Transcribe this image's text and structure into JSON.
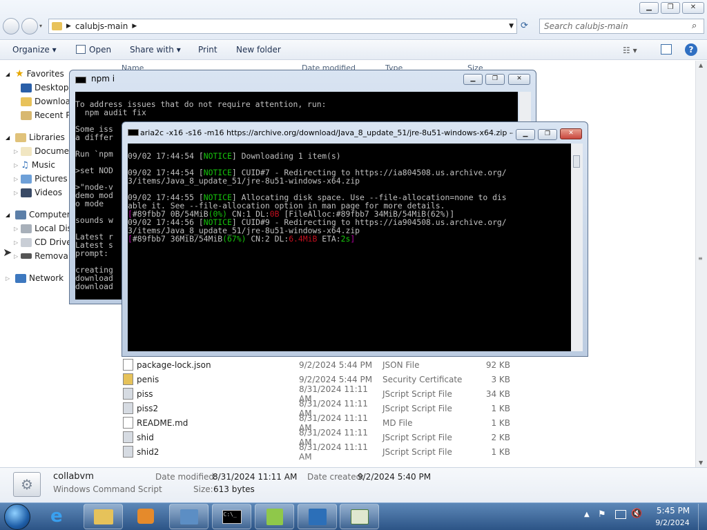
{
  "explorer": {
    "breadcrumb": "calubjs-main",
    "search_placeholder": "Search calubjs-main",
    "toolbar": {
      "organize": "Organize ▾",
      "open": "Open",
      "share_with": "Share with ▾",
      "print": "Print",
      "new_folder": "New folder"
    },
    "columns": {
      "name": "Name",
      "date": "Date modified",
      "type": "Type",
      "size": "Size"
    },
    "nav": {
      "favorites": "Favorites",
      "desktop": "Desktop",
      "downloads": "Downloads",
      "recent": "Recent Pl",
      "libraries": "Libraries",
      "documents": "Documen",
      "music": "Music",
      "pictures": "Pictures",
      "videos": "Videos",
      "computer": "Computer",
      "local_disk": "Local Disk",
      "cd_drive": "CD Drive",
      "removable": "Removab",
      "network": "Network"
    },
    "files": [
      {
        "name": "package-lock.json",
        "date": "9/2/2024 5:44 PM",
        "type": "JSON File",
        "size": "92 KB"
      },
      {
        "name": "penis",
        "date": "9/2/2024 5:44 PM",
        "type": "Security Certificate",
        "size": "3 KB"
      },
      {
        "name": "piss",
        "date": "8/31/2024 11:11 AM",
        "type": "JScript Script File",
        "size": "34 KB"
      },
      {
        "name": "piss2",
        "date": "8/31/2024 11:11 AM",
        "type": "JScript Script File",
        "size": "1 KB"
      },
      {
        "name": "README.md",
        "date": "8/31/2024 11:11 AM",
        "type": "MD File",
        "size": "1 KB"
      },
      {
        "name": "shid",
        "date": "8/31/2024 11:11 AM",
        "type": "JScript Script File",
        "size": "2 KB"
      },
      {
        "name": "shid2",
        "date": "8/31/2024 11:11 AM",
        "type": "JScript Script File",
        "size": "1 KB"
      }
    ],
    "details": {
      "name": "collabvm",
      "kind": "Windows Command Script",
      "modified_label": "Date modified:",
      "modified": "8/31/2024 11:11 AM",
      "created_label": "Date created:",
      "created": "9/2/2024 5:40 PM",
      "size_label": "Size:",
      "size": "613 bytes"
    }
  },
  "npm_window": {
    "title": "npm i",
    "lines": [
      "To address issues that do not require attention, run:",
      "  npm audit fix",
      "",
      "Some iss",
      "a differ",
      "",
      "Run `npm",
      "",
      ">set NOD",
      "",
      ">\"node-v",
      "demo mod",
      "o mode",
      "",
      "sounds w",
      "",
      "Latest r",
      "Latest s",
      "prompt: ",
      "",
      "creating",
      "download",
      "download"
    ]
  },
  "aria_window": {
    "title": "aria2c  -x16 -s16 -m16 https://archive.org/download/Java_8_update_51/jre-8u51-windows-x64.zip --...",
    "lines": [
      [
        {
          "t": "09/02 17:44:54 ["
        },
        {
          "t": "NOTICE",
          "c": "g"
        },
        {
          "t": "] Downloading 1 item(s)"
        }
      ],
      [
        {
          "t": ""
        }
      ],
      [
        {
          "t": "09/02 17:44:54 ["
        },
        {
          "t": "NOTICE",
          "c": "g"
        },
        {
          "t": "] CUID#7 - Redirecting to https://ia804508.us.archive.org/"
        }
      ],
      [
        {
          "t": "3/items/Java_8_update_51/jre-8u51-windows-x64.zip"
        }
      ],
      [
        {
          "t": ""
        }
      ],
      [
        {
          "t": "09/02 17:44:55 ["
        },
        {
          "t": "NOTICE",
          "c": "g"
        },
        {
          "t": "] Allocating disk space. Use --file-allocation=none to dis"
        }
      ],
      [
        {
          "t": "able it. See --file-allocation option in man page for more details."
        }
      ],
      [
        {
          "t": "[",
          "c": "m"
        },
        {
          "t": "#89fbb7 0B/54MiB"
        },
        {
          "t": "(0%)",
          "c": "g"
        },
        {
          "t": " CN:1 DL:"
        },
        {
          "t": "0B",
          "c": "r"
        },
        {
          "t": " [FileAlloc:#89fbb7 34MiB/54MiB(62%)]"
        }
      ],
      [
        {
          "t": "09/02 17:44:56 ["
        },
        {
          "t": "NOTICE",
          "c": "g"
        },
        {
          "t": "] CUID#9 - Redirecting to https://ia904508.us.archive.org/"
        }
      ],
      [
        {
          "t": "3/items/Java_8_update_51/jre-8u51-windows-x64.zip"
        }
      ],
      [
        {
          "t": "[",
          "c": "m"
        },
        {
          "t": "#89fbb7 36MiB/54MiB"
        },
        {
          "t": "(67%)",
          "c": "g"
        },
        {
          "t": " CN:2 DL:"
        },
        {
          "t": "6.4MiB",
          "c": "r"
        },
        {
          "t": " ETA:"
        },
        {
          "t": "2s",
          "c": "g"
        },
        {
          "t": "]",
          "c": "m"
        }
      ]
    ]
  },
  "taskbar": {
    "time": "5:45 PM",
    "date": "9/2/2024"
  },
  "colors": {
    "notice": "#16c60c",
    "progress_bracket": "#b4009e",
    "speed": "#c50f1f",
    "close_button": "#c9463d"
  }
}
